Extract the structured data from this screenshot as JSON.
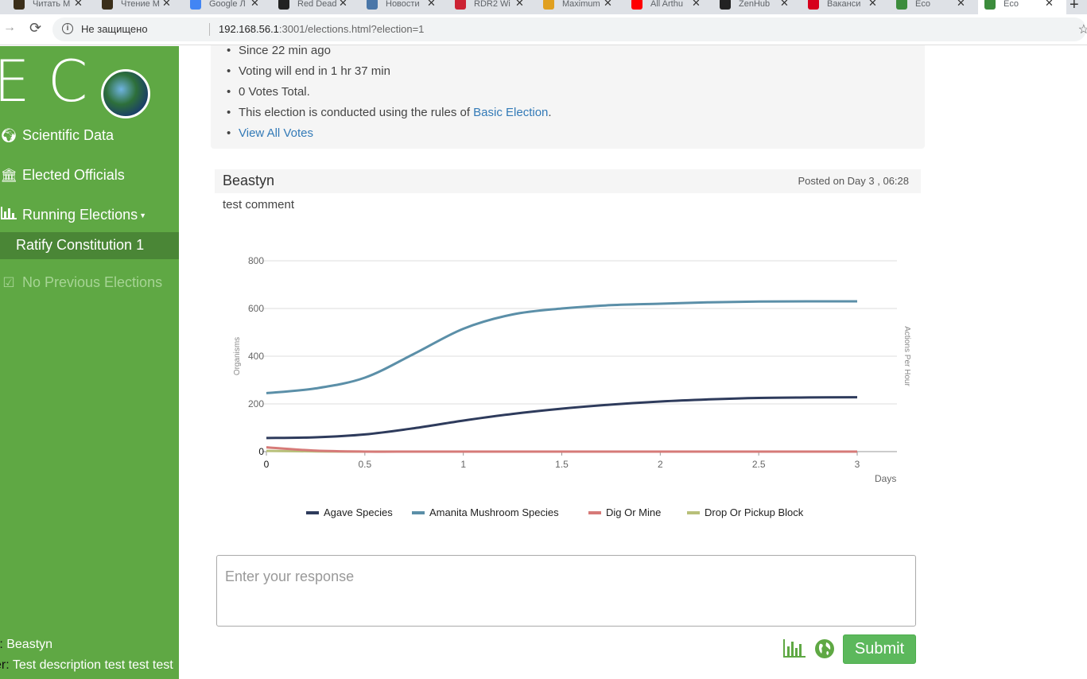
{
  "browser": {
    "tabs": [
      {
        "label": "Читать М",
        "color": "#3b2f1a"
      },
      {
        "label": "Чтение М",
        "color": "#3b2f1a"
      },
      {
        "label": "Google Л",
        "color": "#4285f4"
      },
      {
        "label": "Red Dead",
        "color": "#222222"
      },
      {
        "label": "Новости",
        "color": "#4a76a8"
      },
      {
        "label": "RDR2 Wi",
        "color": "#cc2233"
      },
      {
        "label": "Maximum",
        "color": "#e0a020"
      },
      {
        "label": "All Arthu",
        "color": "#ff0000"
      },
      {
        "label": "ZenHub",
        "color": "#222222"
      },
      {
        "label": "Ваканси",
        "color": "#d6001c"
      },
      {
        "label": "Eco",
        "color": "#3c8c3c"
      },
      {
        "label": "Eco",
        "color": "#3c8c3c"
      }
    ],
    "new_tab": "+",
    "insecure_label": "Не защищено",
    "url_host": "192.168.56.1",
    "url_rest": ":3001/elections.html?election=1"
  },
  "sidebar": {
    "logo_letters": [
      "E",
      "C"
    ],
    "items": [
      {
        "label": "Scientific Data",
        "icon": "globe-icon"
      },
      {
        "label": "Elected Officials",
        "icon": "institution-icon"
      },
      {
        "label": "Running Elections",
        "icon": "bar-chart-icon"
      }
    ],
    "sub_item": "Ratify Constitution 1",
    "disabled_item": "No Previous Elections",
    "footer": [
      {
        "label": "r:",
        "value": "Beastyn"
      },
      {
        "label": "ver:",
        "value": "Test description test test test"
      }
    ]
  },
  "election_info": {
    "items": [
      "Since 22 min ago",
      "Voting will end in 1 hr 37 min",
      "0 Votes Total."
    ],
    "rules_prefix": "This election is conducted using the rules of ",
    "rules_link": "Basic Election",
    "rules_suffix": ".",
    "view_votes": "View All Votes"
  },
  "comment": {
    "author": "Beastyn",
    "date": "Posted on Day 3 , 06:28",
    "body": "test comment"
  },
  "chart_data": {
    "type": "line",
    "xlabel": "Days",
    "ylabel": "Organisms",
    "y2label": "Actions Per Hour",
    "xlim": [
      0,
      3
    ],
    "ylim": [
      0,
      800
    ],
    "xticks": [
      "0",
      "0.5",
      "1",
      "1.5",
      "2",
      "2.5",
      "3"
    ],
    "yticks": [
      "0",
      "200",
      "400",
      "600",
      "800"
    ],
    "legend_position": "bottom",
    "series": [
      {
        "name": "Agave Species",
        "color": "#2e3b5c",
        "x": [
          0,
          0.25,
          0.5,
          0.75,
          1,
          1.25,
          1.5,
          1.75,
          2,
          2.25,
          2.5,
          2.75,
          3
        ],
        "y": [
          57,
          60,
          72,
          98,
          130,
          158,
          180,
          197,
          210,
          219,
          225,
          227,
          228
        ]
      },
      {
        "name": "Amanita Mushroom Species",
        "color": "#5b8fa8",
        "x": [
          0,
          0.25,
          0.5,
          0.75,
          1,
          1.25,
          1.5,
          1.75,
          2,
          2.25,
          2.5,
          2.75,
          3
        ],
        "y": [
          245,
          265,
          310,
          410,
          515,
          575,
          600,
          614,
          620,
          626,
          629,
          630,
          630
        ]
      },
      {
        "name": "Dig Or Mine",
        "color": "#d67a78",
        "x": [
          0,
          0.25,
          0.5,
          0.75,
          1,
          1.5,
          2,
          2.5,
          3
        ],
        "y": [
          18,
          4,
          0,
          0,
          0,
          0,
          0,
          0,
          0
        ]
      },
      {
        "name": "Drop Or Pickup Block",
        "color": "#b8c07a",
        "x": [
          0,
          0.25,
          0.5,
          1,
          1.5,
          2,
          2.5,
          3
        ],
        "y": [
          3,
          1,
          0,
          0,
          0,
          0,
          0,
          0
        ]
      }
    ]
  },
  "response": {
    "placeholder": "Enter your response"
  },
  "submit_label": "Submit"
}
